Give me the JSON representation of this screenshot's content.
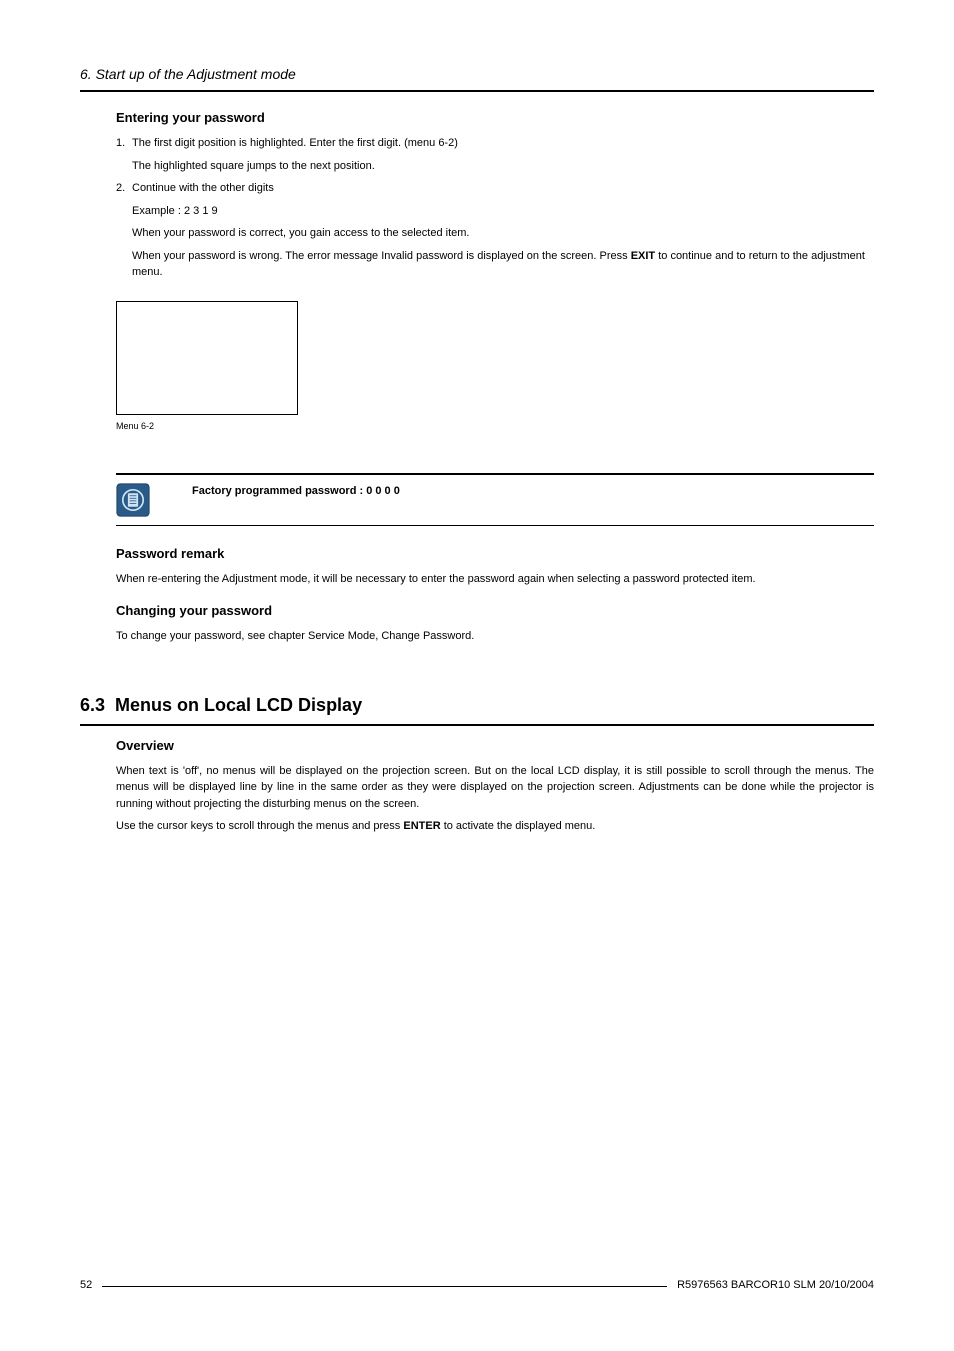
{
  "header": {
    "chapter": "6.  Start up of the Adjustment mode"
  },
  "entering_password": {
    "title": "Entering your password",
    "step1_num": "1.",
    "step1_text": "The first digit position is highlighted.  Enter the first digit.  (menu 6-2)",
    "step1_sub": "The highlighted square jumps to the next position.",
    "step2_num": "2.",
    "step2_text": "Continue with the other digits",
    "example": "Example :  2 3 1 9",
    "correct": "When your password is correct, you gain access to the selected item.",
    "wrong_pre": "When your password is wrong.  The error message Invalid password is displayed on the screen.  Press ",
    "wrong_bold": "EXIT",
    "wrong_post": " to continue and to return to the adjustment menu.",
    "figure_caption": "Menu 6-2"
  },
  "note": {
    "text": "Factory programmed password :  0 0 0 0"
  },
  "password_remark": {
    "title": "Password remark",
    "text": "When re-entering the Adjustment mode, it will be necessary to enter the password again when selecting a password protected item."
  },
  "changing_password": {
    "title": "Changing your password",
    "text": "To change your password, see chapter Service Mode, Change Password."
  },
  "section_6_3": {
    "number": "6.3",
    "title": "Menus on Local LCD Display",
    "overview_title": "Overview",
    "overview_p1": "When text is 'off', no menus will be displayed on the projection screen.  But on the local LCD display, it is still possible to scroll through the menus.  The menus will be displayed line by line in the same order as they were displayed on the projection screen. Adjustments can be done while the projector is running without projecting the disturbing menus on the screen.",
    "overview_p2_pre": "Use the cursor keys to scroll through the menus and press ",
    "overview_p2_bold": "ENTER",
    "overview_p2_post": " to activate the displayed menu."
  },
  "footer": {
    "page": "52",
    "doc": "R5976563  BARCOR10 SLM  20/10/2004"
  }
}
